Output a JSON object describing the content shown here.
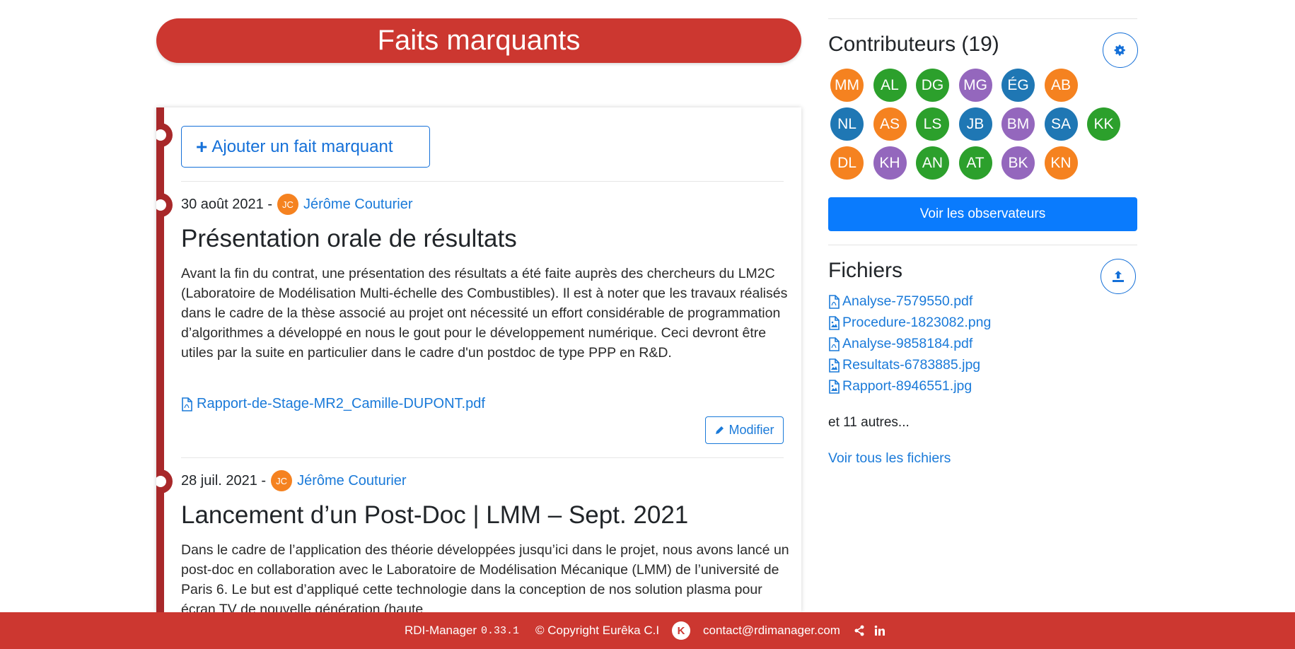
{
  "banner": {
    "title": "Faits marquants"
  },
  "timeline": {
    "add_button": "Ajouter un fait marquant",
    "posts": [
      {
        "date": "30 août 2021 -",
        "author_initials": "JC",
        "author": "Jérôme Couturier",
        "title": "Présentation orale de résultats",
        "body": "Avant la fin du contrat, une présentation des résultats a été faite auprès des chercheurs du LM2C (Laboratoire de Modélisation Multi-échelle des Combustibles). Il est à noter que les travaux réalisés dans le cadre de la thèse associé au projet ont nécessité un effort considérable de programmation d’algorithmes a développé en nous le gout pour le développement numérique. Ceci devront être utiles par la suite en particulier dans le cadre d'un postdoc de type PPP en R&D.",
        "attachment": "Rapport-de-Stage-MR2_Camille-DUPONT.pdf",
        "edit_label": "Modifier"
      },
      {
        "date": "28 juil. 2021 -",
        "author_initials": "JC",
        "author": "Jérôme Couturier",
        "title": "Lancement d’un Post-Doc | LMM – Sept. 2021",
        "body": "Dans le cadre de l’application des théorie développées jusqu’ici dans le projet, nous avons lancé un post-doc en collaboration avec le Laboratoire de Modélisation Mécanique (LMM) de l’université de Paris 6. Le but est d’appliqué cette technologie dans la conception de nos solution plasma pour écran TV de nouvelle génération (haute"
      }
    ]
  },
  "contributors": {
    "title": "Contributeurs (19)",
    "settings_icon": "gear-icon",
    "people": [
      {
        "initials": "MM",
        "color": "#f58220"
      },
      {
        "initials": "AL",
        "color": "#2ca02c"
      },
      {
        "initials": "DG",
        "color": "#2ca02c"
      },
      {
        "initials": "MG",
        "color": "#9467bd"
      },
      {
        "initials": "ÉG",
        "color": "#1f77b4"
      },
      {
        "initials": "AB",
        "color": "#f58220"
      },
      {
        "initials": "NL",
        "color": "#1f77b4"
      },
      {
        "initials": "AS",
        "color": "#f58220"
      },
      {
        "initials": "LS",
        "color": "#2ca02c"
      },
      {
        "initials": "JB",
        "color": "#1f77b4"
      },
      {
        "initials": "BM",
        "color": "#9467bd"
      },
      {
        "initials": "SA",
        "color": "#1f77b4"
      },
      {
        "initials": "KK",
        "color": "#2ca02c"
      },
      {
        "initials": "DL",
        "color": "#f58220"
      },
      {
        "initials": "KH",
        "color": "#9467bd"
      },
      {
        "initials": "AN",
        "color": "#2ca02c"
      },
      {
        "initials": "AT",
        "color": "#2ca02c"
      },
      {
        "initials": "BK",
        "color": "#9467bd"
      },
      {
        "initials": "KN",
        "color": "#f58220"
      }
    ],
    "observers_button": "Voir les observateurs"
  },
  "files": {
    "title": "Fichiers",
    "upload_icon": "upload-icon",
    "items": [
      {
        "name": "Analyse-7579550.pdf",
        "icon": "pdf-file-icon"
      },
      {
        "name": "Procedure-1823082.png",
        "icon": "image-file-icon"
      },
      {
        "name": "Analyse-9858184.pdf",
        "icon": "pdf-file-icon"
      },
      {
        "name": "Resultats-6783885.jpg",
        "icon": "image-file-icon"
      },
      {
        "name": "Rapport-8946551.jpg",
        "icon": "image-file-icon"
      }
    ],
    "more": "et 11 autres...",
    "see_all": "Voir tous les fichiers"
  },
  "footer": {
    "app_name": "RDI-Manager",
    "version": "0.33.1",
    "copyright": "© Copyright Eurêka C.I",
    "logo_letter": "K",
    "contact": "contact@rdimanager.com"
  }
}
